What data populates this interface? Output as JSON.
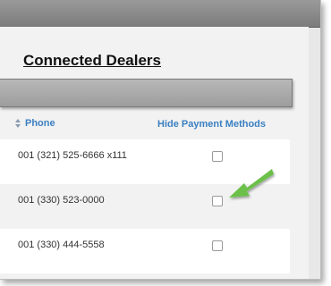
{
  "page": {
    "title": "Connected Dealers"
  },
  "table": {
    "headers": {
      "phone": "Phone",
      "hide_payment_methods": "Hide Payment Methods"
    },
    "rows": [
      {
        "phone": "001 (321) 525-6666 x111",
        "hide_payment_methods": false
      },
      {
        "phone": "001 (330) 523-0000",
        "hide_payment_methods": false
      },
      {
        "phone": "001 (330) 444-5558",
        "hide_payment_methods": false
      }
    ]
  },
  "annotation": {
    "arrow_icon": "green-arrow-icon",
    "arrow_color": "#6cc04a"
  },
  "colors": {
    "header_text": "#3a7fc1"
  }
}
